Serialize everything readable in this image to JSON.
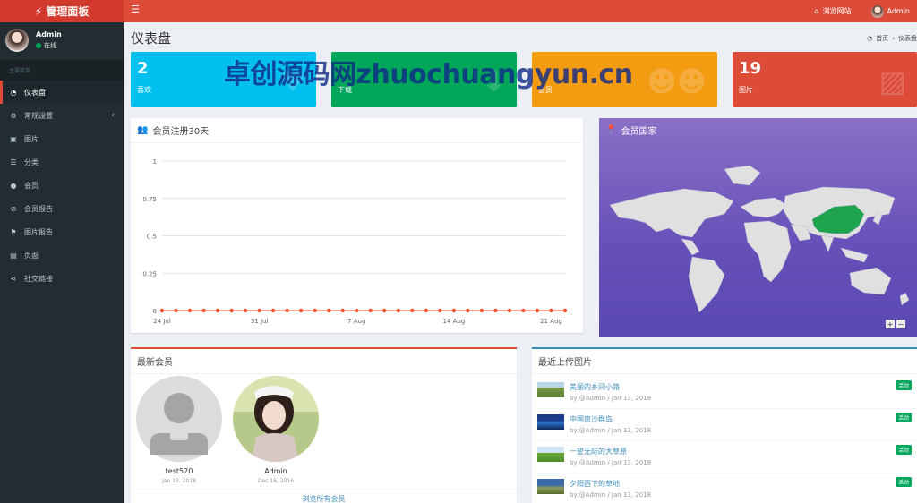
{
  "header": {
    "logo": "管理面板",
    "browse_site": "浏览网站",
    "user_name": "Admin"
  },
  "sidebar": {
    "user_name": "Admin",
    "user_status": "在线",
    "menu_header": "主要菜单",
    "items": [
      {
        "label": "仪表盘",
        "icon": "dashboard-icon"
      },
      {
        "label": "常规设置",
        "icon": "cogs-icon"
      },
      {
        "label": "图片",
        "icon": "image-icon"
      },
      {
        "label": "分类",
        "icon": "list-icon"
      },
      {
        "label": "会员",
        "icon": "user-icon"
      },
      {
        "label": "会员报告",
        "icon": "ban-icon"
      },
      {
        "label": "图片报告",
        "icon": "flag-icon"
      },
      {
        "label": "页面",
        "icon": "file-icon"
      },
      {
        "label": "社交链接",
        "icon": "share-icon"
      }
    ]
  },
  "page": {
    "title": "仪表盘",
    "breadcrumb_home": "首页",
    "breadcrumb_current": "仪表盘"
  },
  "watermark": "卓创源码网zhuochuangyun.cn",
  "stats": [
    {
      "value": "2",
      "label": "喜欢",
      "color": "#00c0ef"
    },
    {
      "value": "",
      "label": "下载",
      "color": "#00a65a"
    },
    {
      "value": "",
      "label": "会员",
      "color": "#f39c12"
    },
    {
      "value": "19",
      "label": "图片",
      "color": "#dd4b39"
    }
  ],
  "registrations": {
    "title": "会员注册30天"
  },
  "chart_data": {
    "type": "line",
    "title": "会员注册30天",
    "x_tick_labels": [
      "24 Jul",
      "31 Jul",
      "7 Aug",
      "14 Aug",
      "21 Aug"
    ],
    "y_ticks": [
      "0",
      "0.25",
      "0.5",
      "0.75",
      "1"
    ],
    "ylim": [
      0,
      1
    ],
    "grid": true,
    "x_start": "24 Jul",
    "x_end": "22 Aug",
    "series": [
      {
        "values": [
          0,
          0,
          0,
          0,
          0,
          0,
          0,
          0,
          0,
          0,
          0,
          0,
          0,
          0,
          0,
          0,
          0,
          0,
          0,
          0,
          0,
          0,
          0,
          0,
          0,
          0,
          0,
          0,
          0,
          0
        ],
        "color": "#f0502a"
      }
    ]
  },
  "map": {
    "title": "会员国家",
    "zoom_in": "+",
    "zoom_out": "−"
  },
  "members": {
    "title": "最新会员",
    "list": [
      {
        "name": "test520",
        "date": "Jan 13, 2018"
      },
      {
        "name": "Admin",
        "date": "Dec 16, 2016"
      }
    ],
    "view_all": "浏览所有会员"
  },
  "uploads": {
    "title": "最近上传图片",
    "list": [
      {
        "title": "美丽的乡间小路",
        "meta": "by @Admin / Jan 13, 2018",
        "badge": "活动"
      },
      {
        "title": "中国南沙群岛",
        "meta": "by @Admin / Jan 13, 2018",
        "badge": "活动"
      },
      {
        "title": "一望无际的大草原",
        "meta": "by @Admin / Jan 13, 2018",
        "badge": "活动"
      },
      {
        "title": "夕阳西下的草地",
        "meta": "by @Admin / Jan 13, 2018",
        "badge": "活动"
      }
    ]
  }
}
